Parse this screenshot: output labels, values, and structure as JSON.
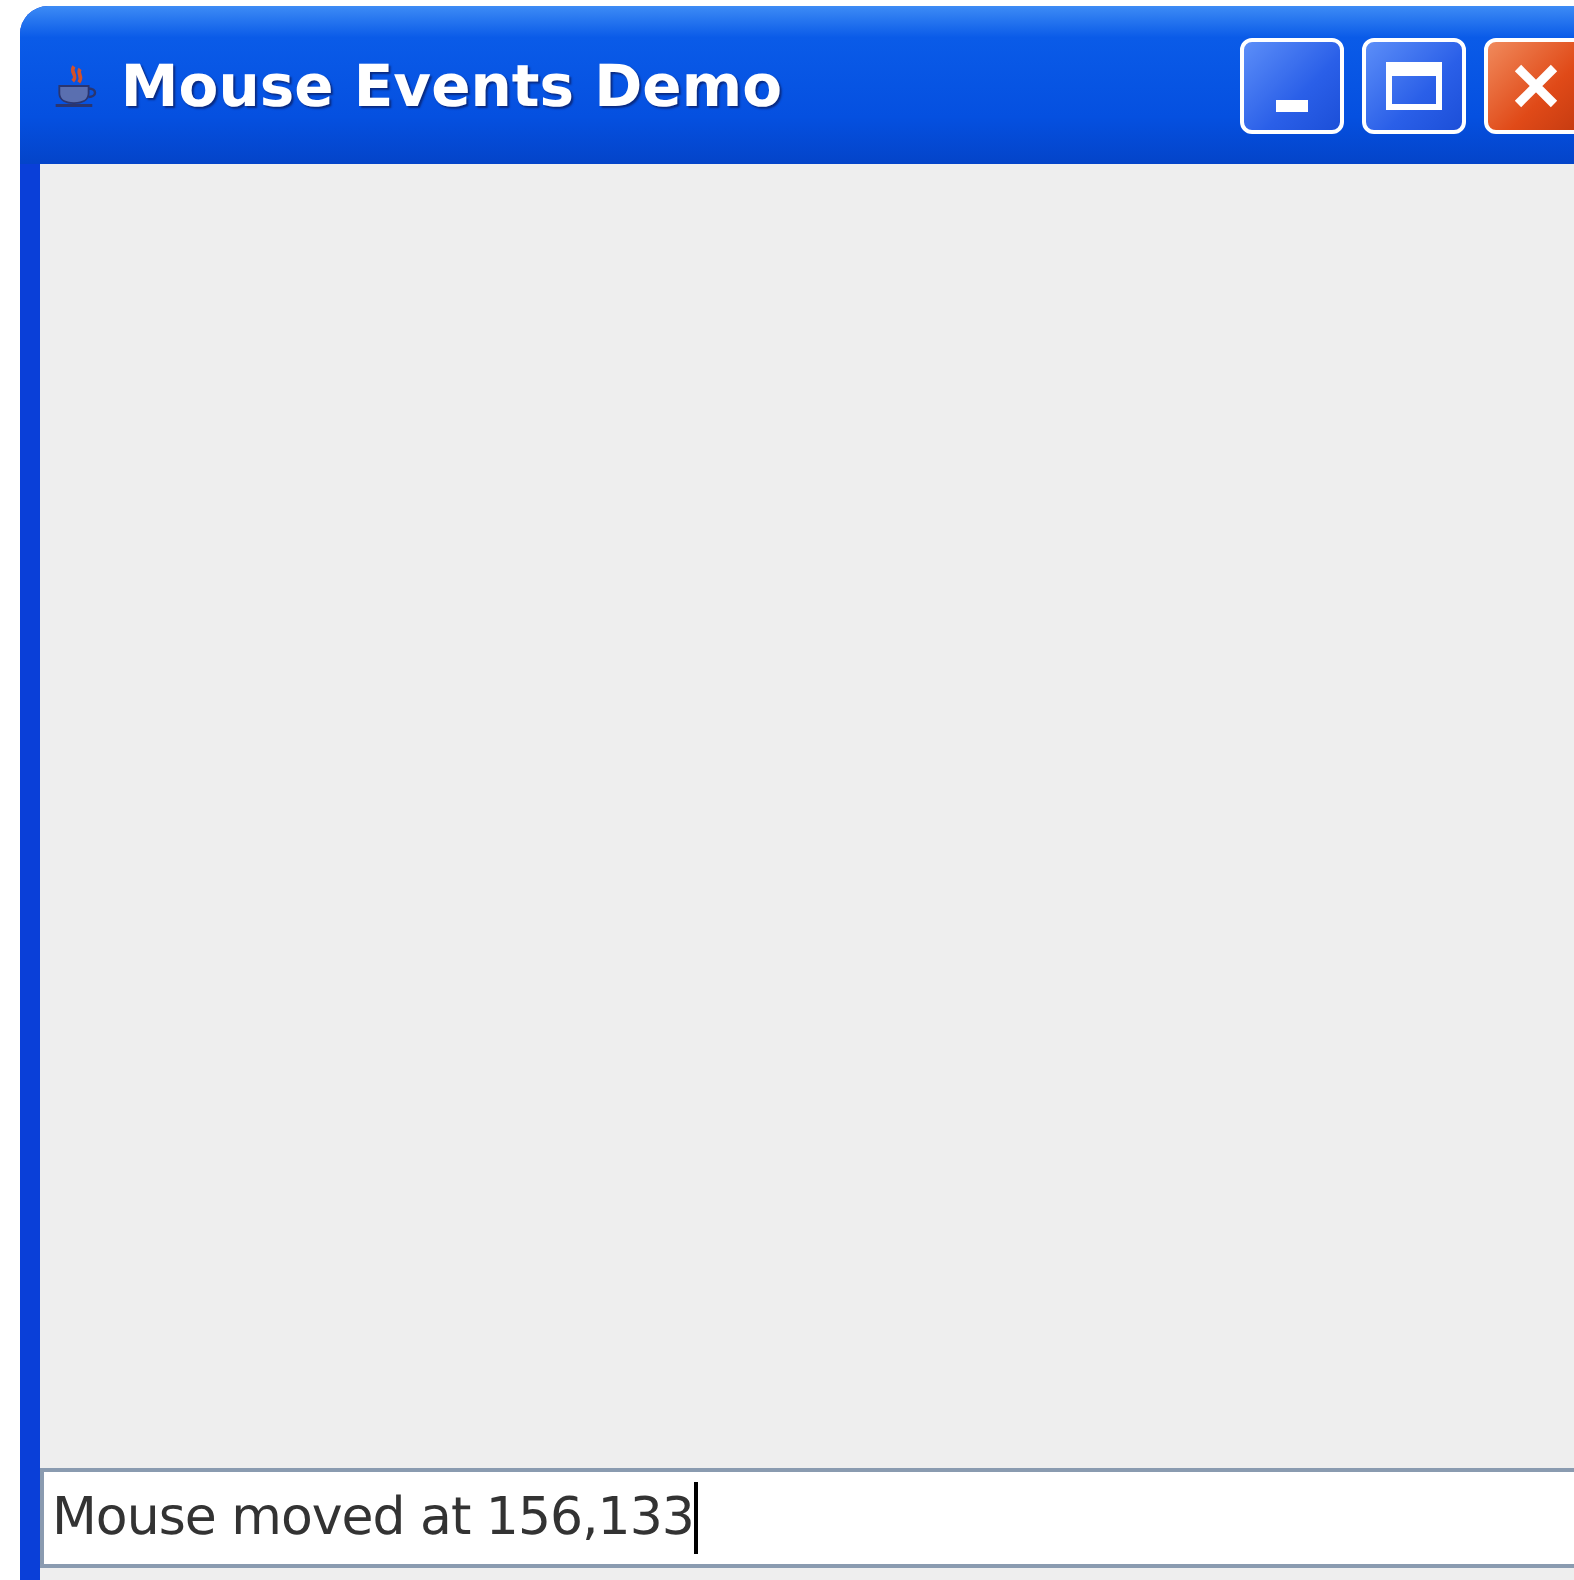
{
  "window": {
    "title": "Mouse Events Demo"
  },
  "text_field": {
    "value": "Mouse moved at 156,133"
  }
}
